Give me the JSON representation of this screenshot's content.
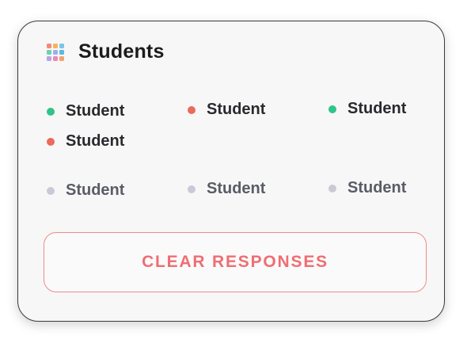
{
  "card": {
    "title": "Students",
    "icon": "grid-icon"
  },
  "colors": {
    "green": "#2ec48a",
    "red": "#ea6a5c",
    "gray": "#c9cad6",
    "accent": "#ee6e73"
  },
  "students": [
    {
      "label": "Student",
      "status": "green"
    },
    {
      "label": "Student",
      "status": "red"
    },
    {
      "label": "Student",
      "status": "green"
    },
    {
      "label": "Student",
      "status": "red"
    },
    {
      "label": "Student",
      "status": "gray"
    },
    {
      "label": "Student",
      "status": "gray"
    },
    {
      "label": "Student",
      "status": "gray"
    }
  ],
  "actions": {
    "clear_label": "CLEAR RESPONSES"
  }
}
